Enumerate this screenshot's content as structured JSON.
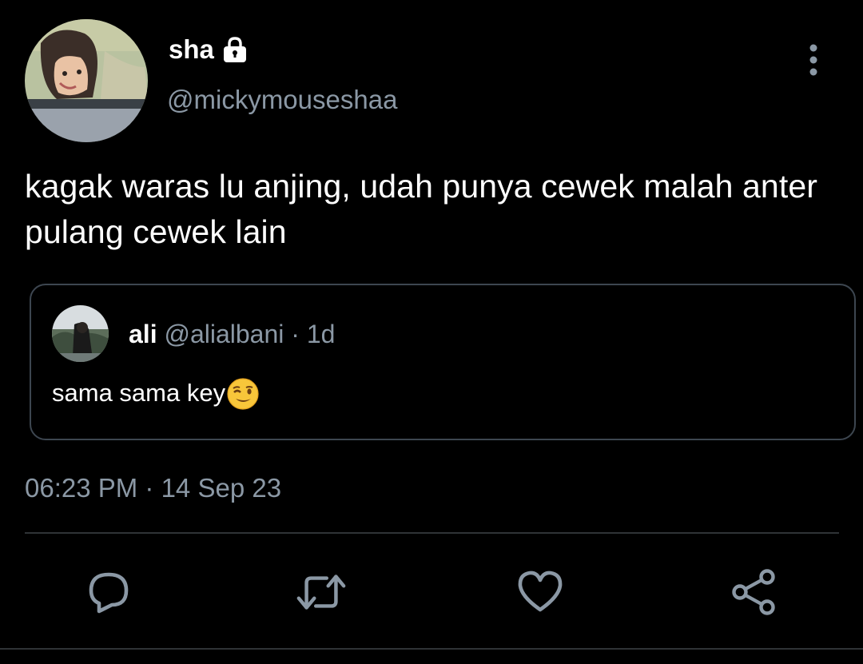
{
  "tweet": {
    "author": {
      "display_name": "sha",
      "handle": "@mickymouseshaa",
      "protected_icon": "lock-icon"
    },
    "text": "kagak waras lu anjing, udah punya cewek malah anter pulang cewek lain",
    "timestamp": "06:23 PM · 14 Sep 23",
    "menu_icon": "more-vertical-icon"
  },
  "quoted_tweet": {
    "display_name": "ali",
    "handle": "@alialbani",
    "separator": " · ",
    "time": "1d",
    "text": "sama sama key",
    "emoji": "winking-face-emoji"
  },
  "actions": [
    {
      "name": "reply",
      "icon": "reply-icon"
    },
    {
      "name": "retweet",
      "icon": "retweet-icon"
    },
    {
      "name": "like",
      "icon": "heart-icon"
    },
    {
      "name": "share",
      "icon": "share-icon"
    }
  ],
  "colors": {
    "background": "#000000",
    "primary_text": "#ffffff",
    "secondary_text": "#8b98a5",
    "border": "#3d4650",
    "divider": "#2f3336"
  }
}
